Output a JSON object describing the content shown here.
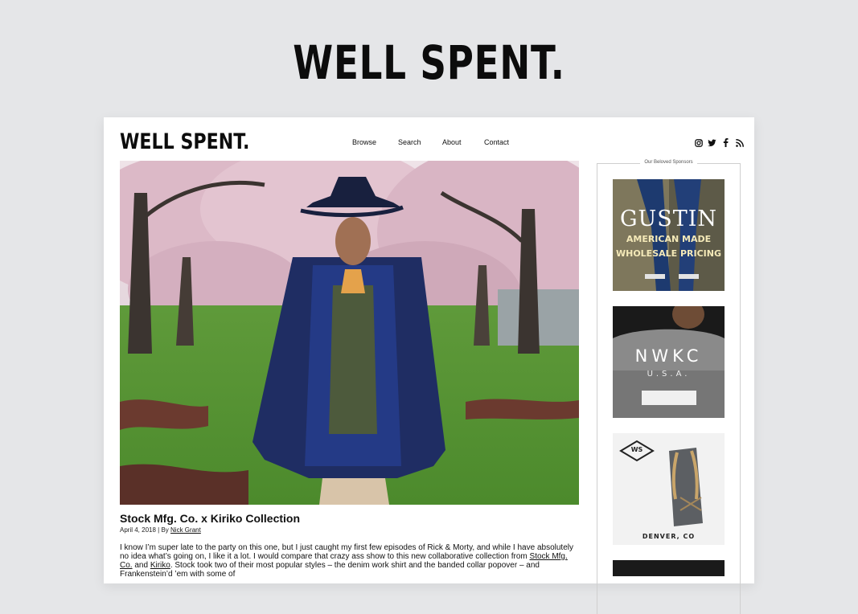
{
  "hero": {
    "logo": "WELL SPENT."
  },
  "header": {
    "logo": "WELL SPENT.",
    "nav": [
      "Browse",
      "Search",
      "About",
      "Contact"
    ],
    "social_icons": [
      "instagram-icon",
      "twitter-icon",
      "facebook-icon",
      "rss-icon"
    ]
  },
  "post": {
    "image_alt": "Man in hat and blue jacket standing among cherry blossom trees",
    "title": "Stock Mfg. Co. x Kiriko Collection",
    "date": "April 4, 2018",
    "by": "| By",
    "author": "Nick Grant",
    "body_1": "I know I’m super late to the party on this one, but I just caught my first few episodes of Rick & Morty, and while I have absolutely no idea what’s going on, I like it a lot. I would compare that crazy ass show to this new collaborative collection from",
    "link_1": "Stock Mfg. Co.",
    "and": "and",
    "link_2": "Kiriko",
    "body_2": ". Stock took two of their most popular styles – the denim work shirt and the banded collar popover – and Frankenstein’d ’em with some of"
  },
  "sidebar": {
    "heading": "Our Beloved Sponsors",
    "ads": [
      {
        "line1": "GUSTIN",
        "line2": "AMERICAN MADE",
        "line3": "WHOLESALE PRICING"
      },
      {
        "line1": "NWKC",
        "line2": "U.S.A."
      },
      {
        "badge": "WS",
        "caption": "DENVER, CO"
      }
    ]
  },
  "colors": {
    "background": "#e5e6e8",
    "card": "#ffffff",
    "text": "#111111"
  }
}
